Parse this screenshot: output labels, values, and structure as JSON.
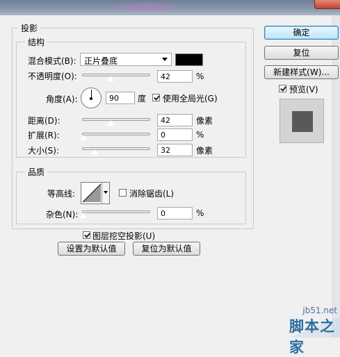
{
  "dialog": {
    "section_title": "投影",
    "structure": {
      "title": "结构",
      "blend_mode_label": "混合模式(B):",
      "blend_mode_value": "正片叠底",
      "blend_color": "#000000",
      "opacity_label": "不透明度(O):",
      "opacity_value": "42",
      "opacity_unit": "%",
      "angle_label": "角度(A):",
      "angle_value": "90",
      "angle_unit": "度",
      "use_global_light_label": "使用全局光(G)",
      "use_global_light_checked": true,
      "distance_label": "距离(D):",
      "distance_value": "42",
      "distance_unit": "像素",
      "spread_label": "扩展(R):",
      "spread_value": "0",
      "spread_unit": "%",
      "size_label": "大小(S):",
      "size_value": "32",
      "size_unit": "像素"
    },
    "quality": {
      "title": "品质",
      "contour_label": "等高线:",
      "anti_aliased_label": "消除锯齿(L)",
      "anti_aliased_checked": false,
      "noise_label": "杂色(N):",
      "noise_value": "0",
      "noise_unit": "%"
    },
    "knockout_label": "图层挖空投影(U)",
    "knockout_checked": true,
    "make_default_button": "设置为默认值",
    "reset_default_button": "复位为默认值"
  },
  "side": {
    "ok_button": "确定",
    "reset_button": "复位",
    "new_style_button": "新建样式(W)...",
    "preview_label": "预览(V)",
    "preview_checked": true
  },
  "watermark": {
    "url": "jb51.net",
    "text": "脚本之家"
  }
}
